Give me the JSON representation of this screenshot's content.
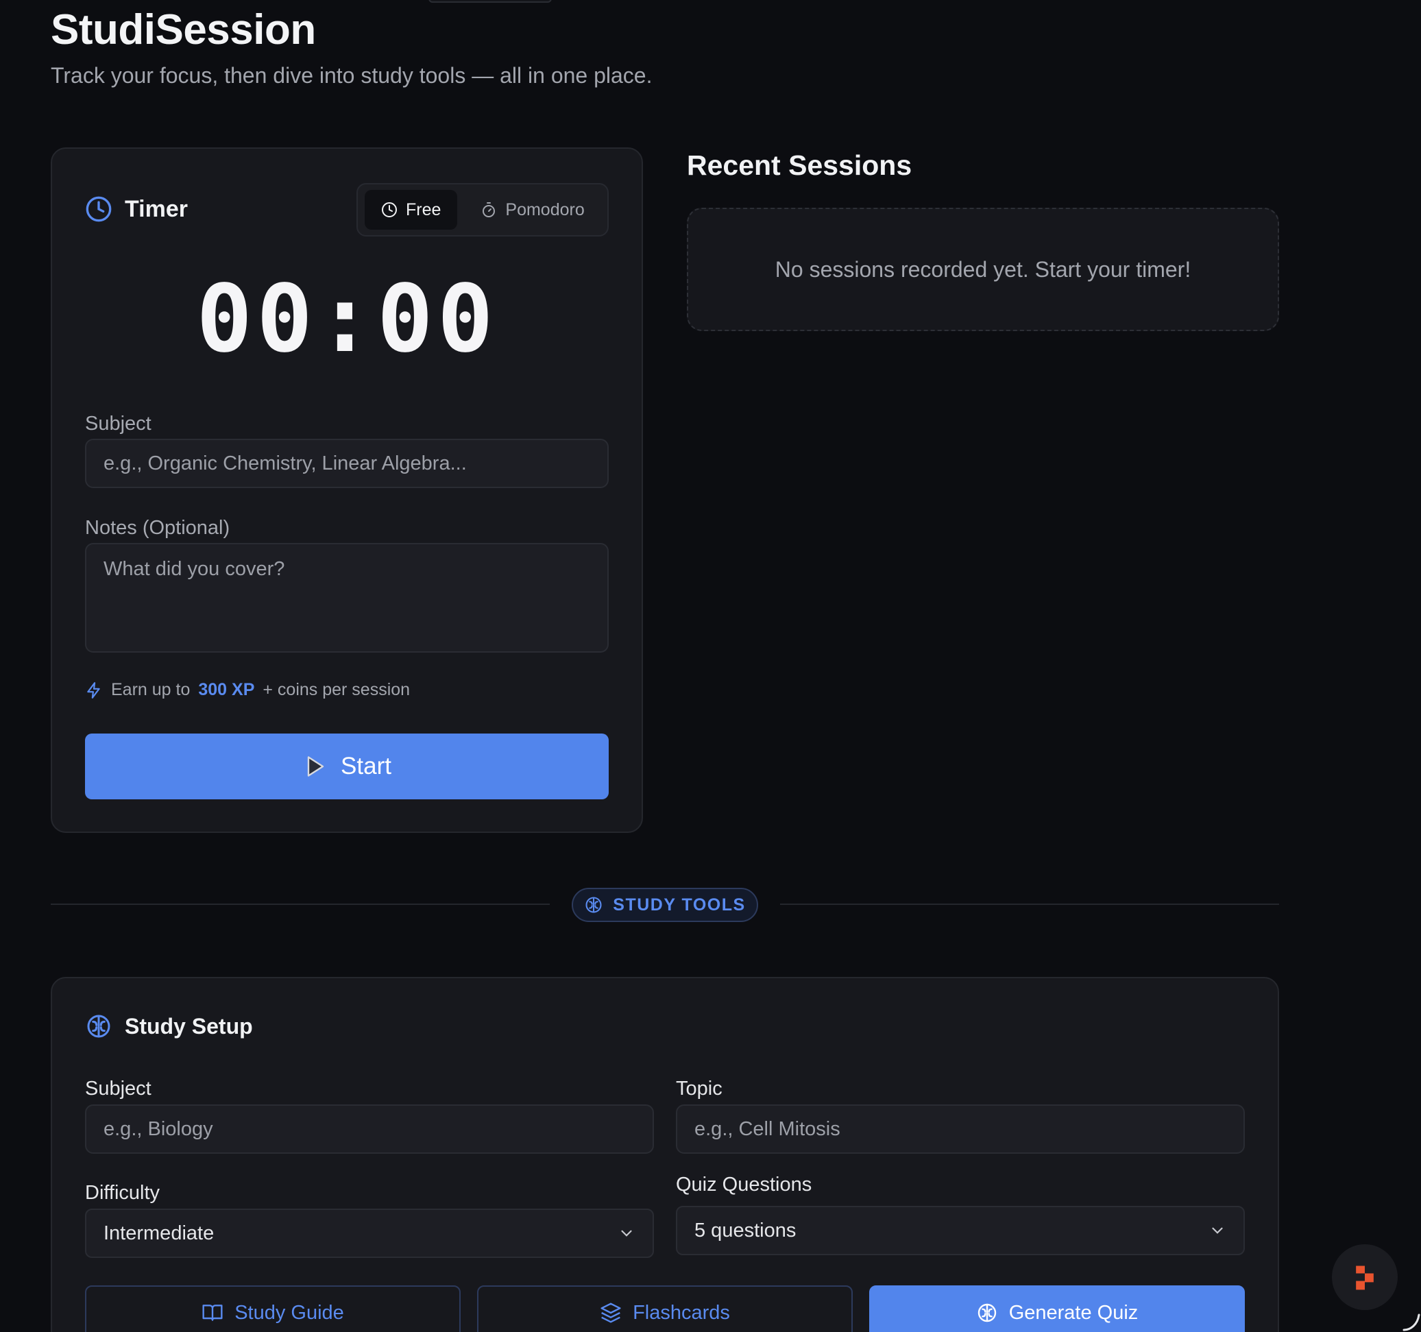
{
  "app": {
    "title": "StudiSession",
    "subtitle": "Track your focus, then dive into study tools — all in one place."
  },
  "timer": {
    "title": "Timer",
    "modes": [
      {
        "label": "Free",
        "active": true,
        "icon": "clock-icon"
      },
      {
        "label": "Pomodoro",
        "active": false,
        "icon": "stopwatch-icon"
      }
    ],
    "display": "00:00",
    "subject_label": "Subject",
    "subject_placeholder": "e.g., Organic Chemistry, Linear Algebra...",
    "notes_label": "Notes (Optional)",
    "notes_placeholder": "What did you cover?",
    "xp_prefix": "Earn up to",
    "xp_amount": "300 XP",
    "xp_suffix": "+ coins per session",
    "start_label": "Start"
  },
  "recent": {
    "title": "Recent Sessions",
    "empty_message": "No sessions recorded yet. Start your timer!"
  },
  "divider": {
    "label": "STUDY TOOLS"
  },
  "setup": {
    "title": "Study Setup",
    "subject_label": "Subject",
    "subject_placeholder": "e.g., Biology",
    "topic_label": "Topic",
    "topic_placeholder": "e.g., Cell Mitosis",
    "difficulty_label": "Difficulty",
    "difficulty_value": "Intermediate",
    "questions_label": "Quiz Questions",
    "questions_value": "5 questions",
    "buttons": {
      "study_guide": "Study Guide",
      "flashcards": "Flashcards",
      "generate_quiz": "Generate Quiz"
    }
  },
  "colors": {
    "accent": "#5285ec",
    "accent_text": "#5a8bf0",
    "background": "#0c0d11",
    "card": "#17181d",
    "fab_brand": "#e8542f"
  }
}
